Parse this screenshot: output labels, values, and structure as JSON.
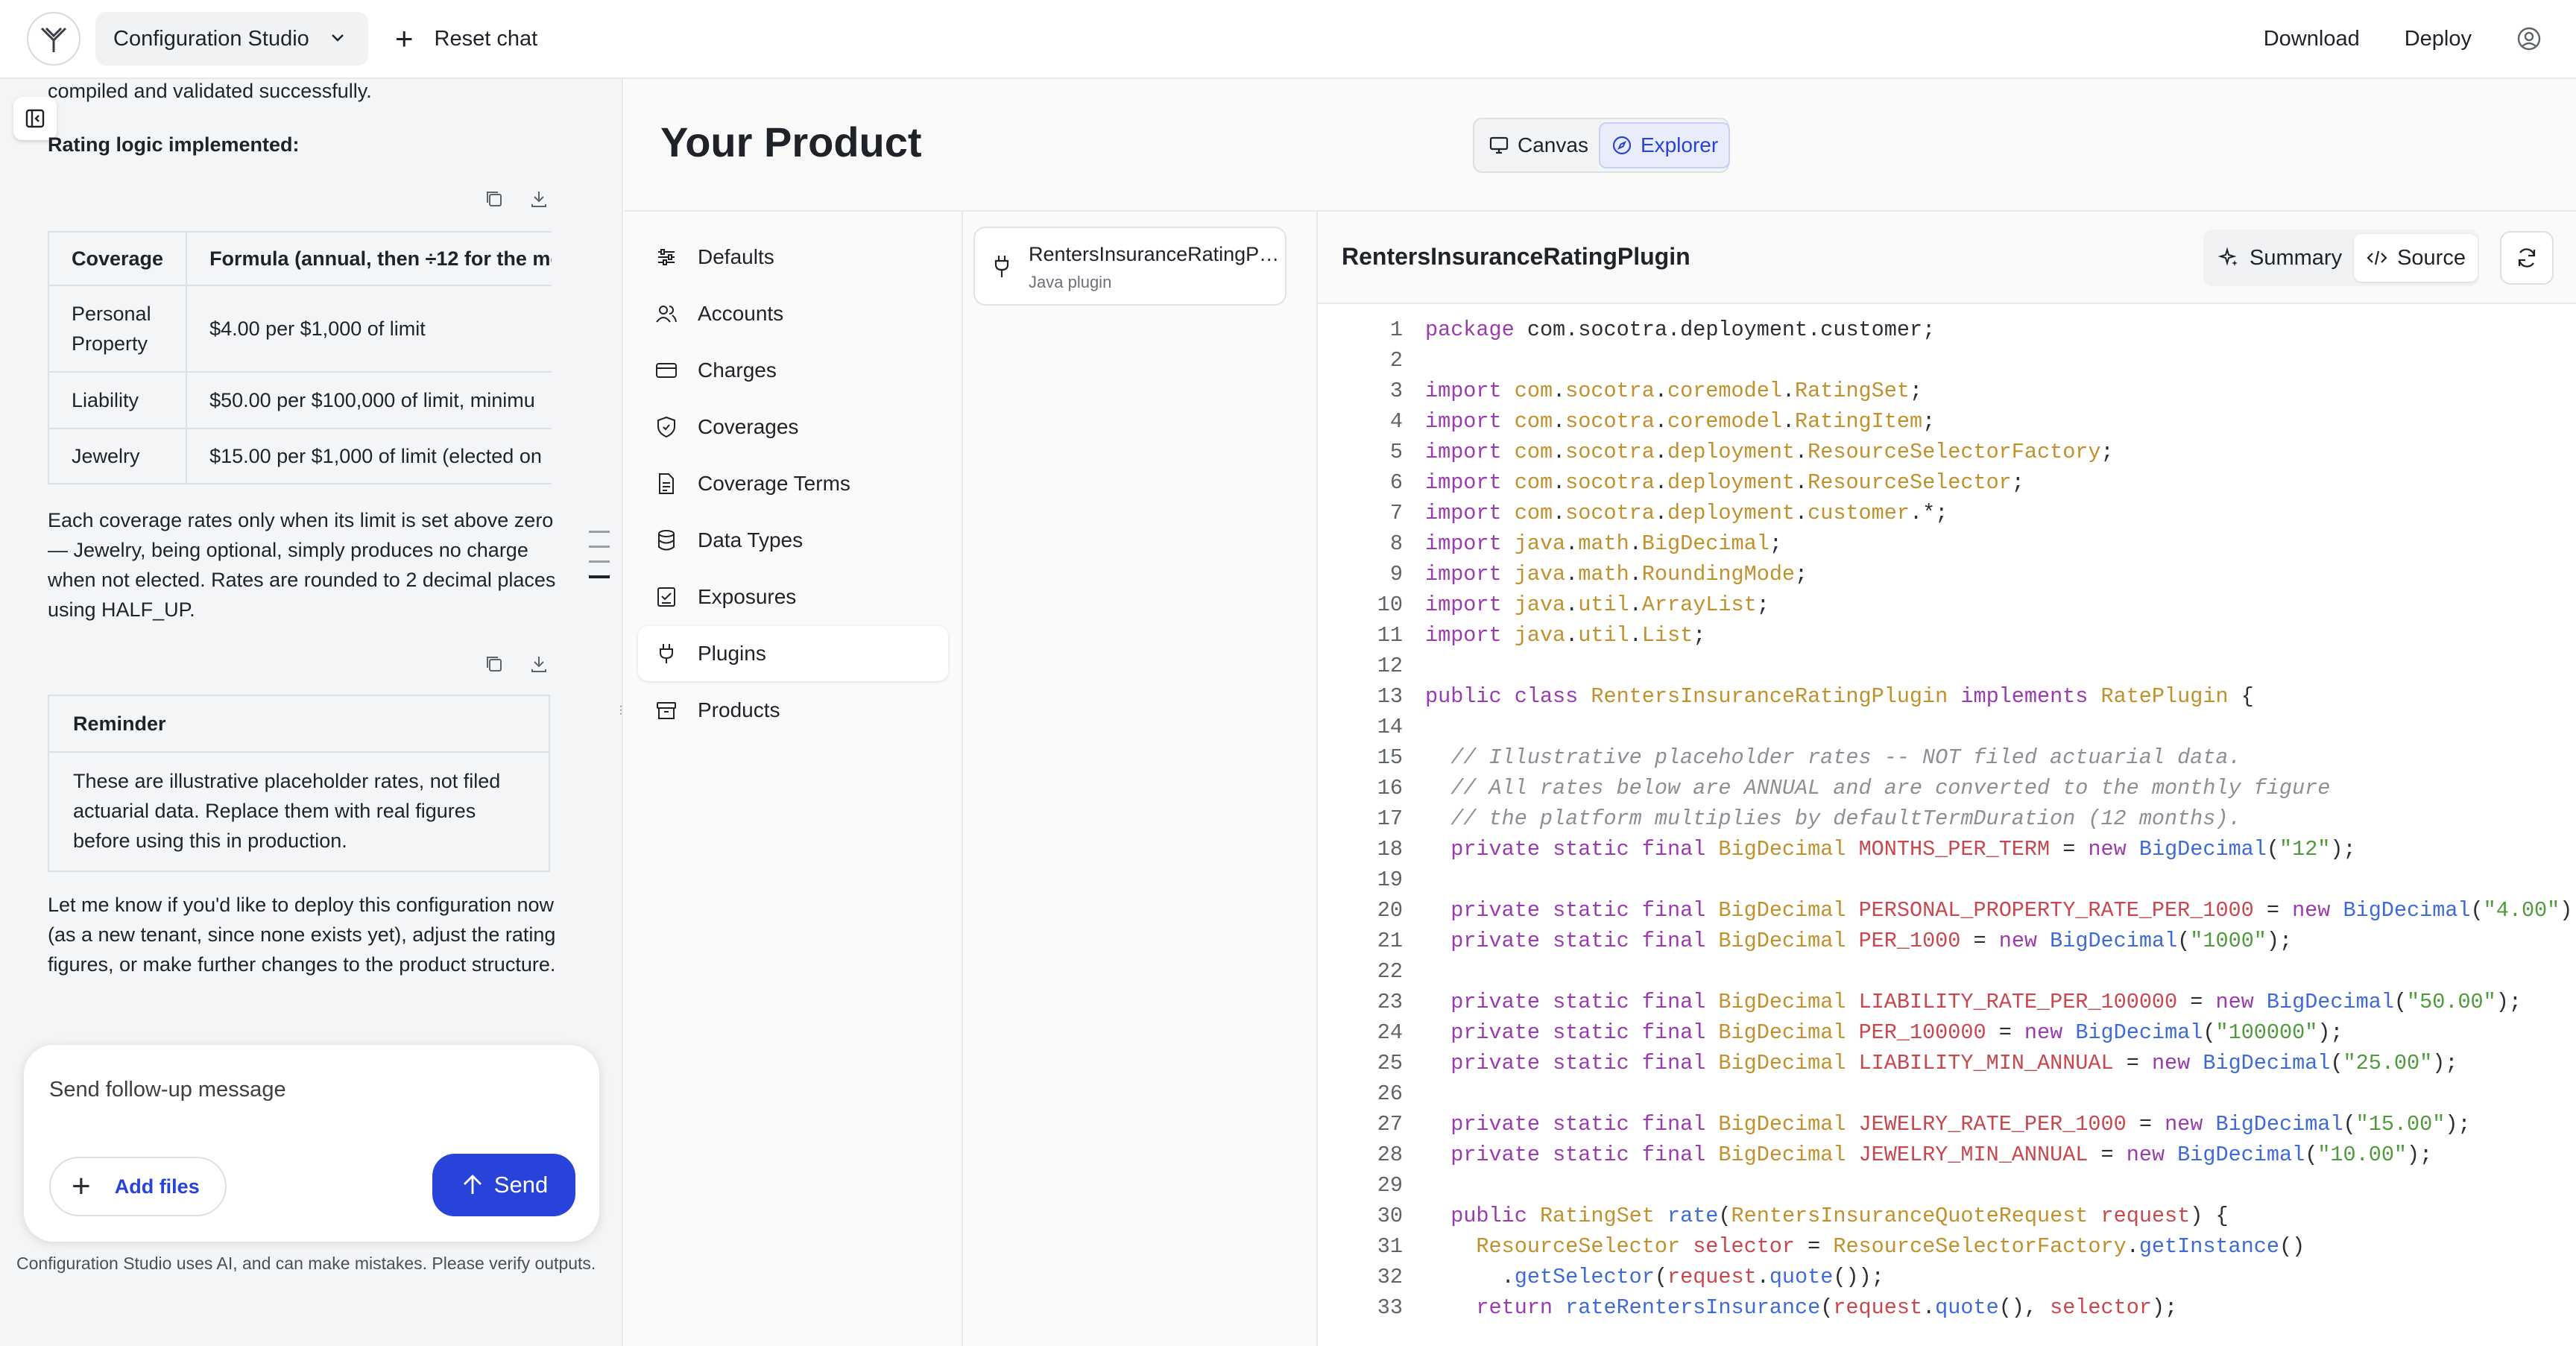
{
  "topbar": {
    "project_name": "Configuration Studio",
    "reset_label": "Reset chat",
    "download_label": "Download",
    "deploy_label": "Deploy"
  },
  "chat": {
    "line_partial": "compiled and validated successfully.",
    "rating_heading": "Rating logic implemented:",
    "table": {
      "headers": [
        "Coverage",
        "Formula (annual, then ÷12 for the mo"
      ],
      "rows": [
        {
          "coverage": "Personal Property",
          "formula": "$4.00 per $1,000 of limit"
        },
        {
          "coverage": "Liability",
          "formula": "$50.00 per $100,000 of limit, minimu"
        },
        {
          "coverage": "Jewelry",
          "formula": "$15.00 per $1,000 of limit (elected on"
        }
      ]
    },
    "para1": "Each coverage rates only when its limit is set above zero — Jewelry, being optional, simply produces no charge when not elected. Rates are rounded to 2 decimal places using HALF_UP.",
    "reminder_title": "Reminder",
    "reminder_body": "These are illustrative placeholder rates, not filed actuarial data. Replace them with real figures before using this in production.",
    "para2": "Let me know if you'd like to deploy this configuration now (as a new tenant, since none exists yet), adjust the rating figures, or make further changes to the product structure.",
    "composer_placeholder": "Send follow-up message",
    "add_files_label": "Add files",
    "send_label": "Send",
    "disclaimer": "Configuration Studio uses AI, and can make mistakes. Please verify outputs."
  },
  "main": {
    "title": "Your Product",
    "view_tabs": {
      "canvas": "Canvas",
      "explorer": "Explorer"
    },
    "nav": [
      {
        "label": "Defaults",
        "icon": "sliders-icon"
      },
      {
        "label": "Accounts",
        "icon": "users-icon"
      },
      {
        "label": "Charges",
        "icon": "credit-card-icon"
      },
      {
        "label": "Coverages",
        "icon": "shield-icon"
      },
      {
        "label": "Coverage Terms",
        "icon": "document-icon"
      },
      {
        "label": "Data Types",
        "icon": "database-icon"
      },
      {
        "label": "Exposures",
        "icon": "checklist-icon"
      },
      {
        "label": "Plugins",
        "icon": "plug-icon"
      },
      {
        "label": "Products",
        "icon": "box-icon"
      }
    ],
    "active_nav": "Plugins",
    "plugin": {
      "name": "RentersInsuranceRatingPlu...",
      "type": "Java plugin"
    },
    "editor": {
      "title": "RentersInsuranceRatingPlugin",
      "summary_label": "Summary",
      "source_label": "Source"
    }
  },
  "code_lines": [
    {
      "n": "1",
      "text": "package com.socotra.deployment.customer;"
    },
    {
      "n": "2",
      "text": ""
    },
    {
      "n": "3",
      "text": "import com.socotra.coremodel.RatingSet;"
    },
    {
      "n": "4",
      "text": "import com.socotra.coremodel.RatingItem;"
    },
    {
      "n": "5",
      "text": "import com.socotra.deployment.ResourceSelectorFactory;"
    },
    {
      "n": "6",
      "text": "import com.socotra.deployment.ResourceSelector;"
    },
    {
      "n": "7",
      "text": "import com.socotra.deployment.customer.*;"
    },
    {
      "n": "8",
      "text": "import java.math.BigDecimal;"
    },
    {
      "n": "9",
      "text": "import java.math.RoundingMode;"
    },
    {
      "n": "10",
      "text": "import java.util.ArrayList;"
    },
    {
      "n": "11",
      "text": "import java.util.List;"
    },
    {
      "n": "12",
      "text": ""
    },
    {
      "n": "13",
      "text": "public class RentersInsuranceRatingPlugin implements RatePlugin {"
    },
    {
      "n": "14",
      "text": ""
    },
    {
      "n": "15",
      "text": "  // Illustrative placeholder rates -- NOT filed actuarial data."
    },
    {
      "n": "16",
      "text": "  // All rates below are ANNUAL and are converted to the monthly figure"
    },
    {
      "n": "17",
      "text": "  // the platform multiplies by defaultTermDuration (12 months)."
    },
    {
      "n": "18",
      "text": "  private static final BigDecimal MONTHS_PER_TERM = new BigDecimal(\"12\");"
    },
    {
      "n": "19",
      "text": ""
    },
    {
      "n": "20",
      "text": "  private static final BigDecimal PERSONAL_PROPERTY_RATE_PER_1000 = new BigDecimal(\"4.00\");"
    },
    {
      "n": "21",
      "text": "  private static final BigDecimal PER_1000 = new BigDecimal(\"1000\");"
    },
    {
      "n": "22",
      "text": ""
    },
    {
      "n": "23",
      "text": "  private static final BigDecimal LIABILITY_RATE_PER_100000 = new BigDecimal(\"50.00\");"
    },
    {
      "n": "24",
      "text": "  private static final BigDecimal PER_100000 = new BigDecimal(\"100000\");"
    },
    {
      "n": "25",
      "text": "  private static final BigDecimal LIABILITY_MIN_ANNUAL = new BigDecimal(\"25.00\");"
    },
    {
      "n": "26",
      "text": ""
    },
    {
      "n": "27",
      "text": "  private static final BigDecimal JEWELRY_RATE_PER_1000 = new BigDecimal(\"15.00\");"
    },
    {
      "n": "28",
      "text": "  private static final BigDecimal JEWELRY_MIN_ANNUAL = new BigDecimal(\"10.00\");"
    },
    {
      "n": "29",
      "text": ""
    },
    {
      "n": "30",
      "text": "  public RatingSet rate(RentersInsuranceQuoteRequest request) {"
    },
    {
      "n": "31",
      "text": "    ResourceSelector selector = ResourceSelectorFactory.getInstance()"
    },
    {
      "n": "32",
      "text": "      .getSelector(request.quote());"
    },
    {
      "n": "33",
      "text": "    return rateRentersInsurance(request.quote(), selector);"
    }
  ]
}
